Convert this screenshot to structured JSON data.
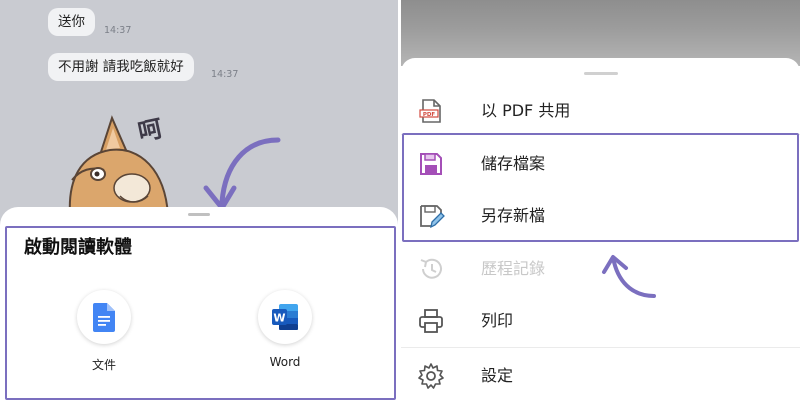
{
  "chat": {
    "messages": [
      {
        "text": "送你",
        "time": "14:37"
      },
      {
        "text": "不用謝 請我吃飯就好",
        "time": "14:37"
      }
    ],
    "sticker_text": "呵"
  },
  "open_with_sheet": {
    "title": "啟動閱讀軟體",
    "apps": [
      {
        "label": "文件",
        "icon": "google-docs-icon"
      },
      {
        "label": "Word",
        "icon": "word-icon"
      }
    ]
  },
  "file_menu": {
    "items": [
      {
        "label": "以 PDF 共用",
        "icon": "pdf-share-icon",
        "enabled": true
      },
      {
        "label": "儲存檔案",
        "icon": "save-icon",
        "enabled": true
      },
      {
        "label": "另存新檔",
        "icon": "save-as-icon",
        "enabled": true
      },
      {
        "label": "歷程記錄",
        "icon": "history-icon",
        "enabled": false
      },
      {
        "label": "列印",
        "icon": "printer-icon",
        "enabled": true
      },
      {
        "label": "設定",
        "icon": "gear-icon",
        "enabled": true
      }
    ]
  },
  "colors": {
    "annotation": "#7b6fbf",
    "chat_background": "#c9cbd1",
    "docs_blue": "#4285f4",
    "word_blue": "#185abd",
    "save_purple": "#a44fb7"
  }
}
